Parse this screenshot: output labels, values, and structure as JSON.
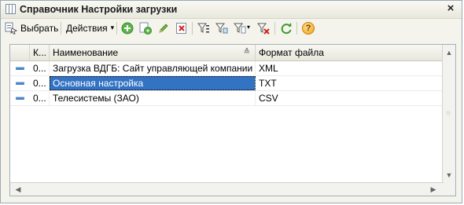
{
  "window": {
    "title": "Справочник Настройки загрузки",
    "close": "×"
  },
  "toolbar": {
    "select_label": "Выбрать",
    "actions_label": "Действия",
    "actions_arrow": "▾",
    "icons": [
      "add-icon",
      "copy-icon",
      "edit-icon",
      "delete-icon",
      "filter-settings-icon",
      "filter-by-value-icon",
      "filter-history-icon",
      "filter-clear-icon",
      "refresh-icon",
      "help-icon"
    ],
    "help_glyph": "?",
    "refresh_glyph": "⟳"
  },
  "grid": {
    "columns": [
      {
        "label": ""
      },
      {
        "label": "К..."
      },
      {
        "label": "Наименование"
      },
      {
        "label": "Формат файла"
      }
    ],
    "sort_indicator": "≙",
    "rows": [
      {
        "code": "0...",
        "name": "Загрузка ВДГБ: Сайт управляющей компании ...",
        "format": "XML"
      },
      {
        "code": "0...",
        "name": "Основная настройка",
        "format": "TXT"
      },
      {
        "code": "0...",
        "name": "Телесистемы (ЗАО)",
        "format": "CSV"
      }
    ],
    "selected_row": 1
  },
  "scroll": {
    "up": "▲",
    "down": "▼",
    "left": "◀",
    "right": "▶"
  },
  "colors": {
    "selection": "#3373c4",
    "row_icon": "#4f87c7"
  }
}
